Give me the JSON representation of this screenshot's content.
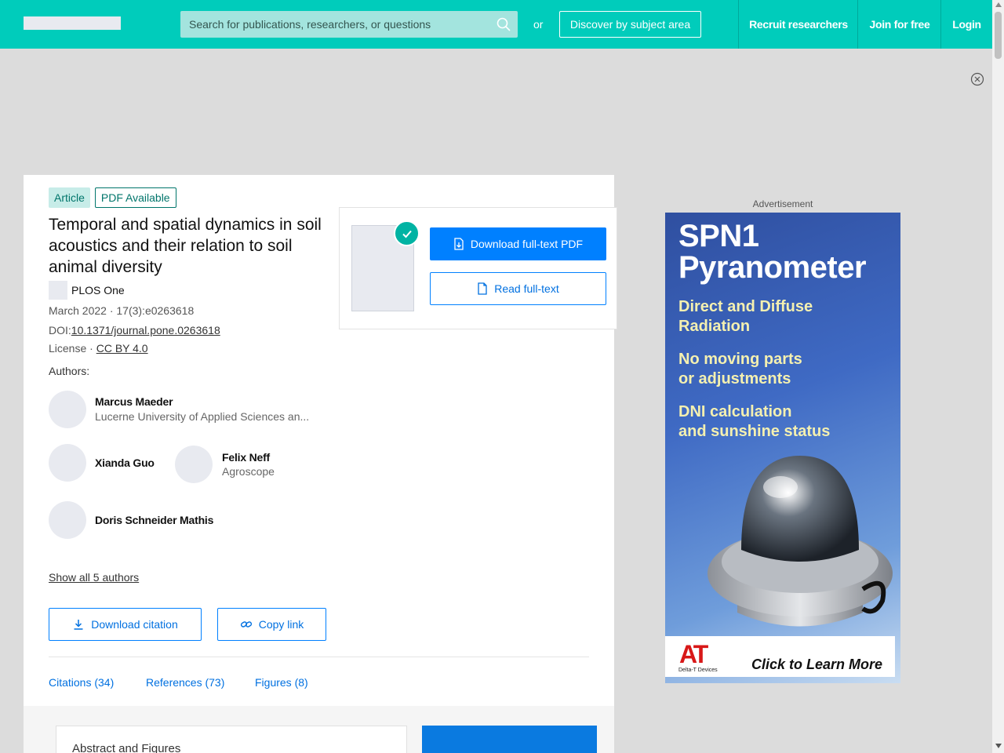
{
  "nav": {
    "search_placeholder": "Search for publications, researchers, or questions",
    "or_text": "or",
    "discover_label": "Discover by subject area",
    "recruit_label": "Recruit researchers",
    "join_label": "Join for free",
    "login_label": "Login"
  },
  "article": {
    "type_badge": "Article",
    "pdf_badge": "PDF Available",
    "title": "Temporal and spatial dynamics in soil acoustics and their relation to soil animal diversity",
    "journal": "PLOS One",
    "date_volume": "March 2022 · 17(3):e0263618",
    "doi_prefix": "DOI:",
    "doi": "10.1371/journal.pone.0263618",
    "license_prefix": "License · ",
    "license": "CC BY 4.0",
    "authors_label": "Authors:",
    "authors": [
      {
        "name": "Marcus Maeder",
        "affiliation": "Lucerne University of Applied Sciences an..."
      },
      {
        "name": "Xianda Guo",
        "affiliation": ""
      },
      {
        "name": "Felix Neff",
        "affiliation": "Agroscope"
      },
      {
        "name": "Doris Schneider Mathis",
        "affiliation": ""
      }
    ],
    "show_all": "Show all 5 authors",
    "download_citation": "Download citation",
    "copy_link": "Copy link",
    "tabs": [
      "Citations (34)",
      "References (73)",
      "Figures (8)"
    ],
    "abstract_title": "Abstract and Figures"
  },
  "pdf_panel": {
    "download_label": "Download full-text PDF",
    "read_label": "Read full-text"
  },
  "ad": {
    "label": "Advertisement",
    "headline_1": "SPN1",
    "headline_2": "Pyranometer",
    "line_1": "Direct and Diffuse",
    "line_2": "Radiation",
    "line_3": "No moving parts",
    "line_4": "or adjustments",
    "line_5": "DNI calculation",
    "line_6": "and sunshine status",
    "brand": "AT",
    "brand_sub": "Delta-T Devices",
    "cta": "Click to Learn More"
  },
  "colors": {
    "brand_teal": "#00ccbb",
    "link_blue": "#0070e0",
    "primary_blue": "#0080ff"
  }
}
